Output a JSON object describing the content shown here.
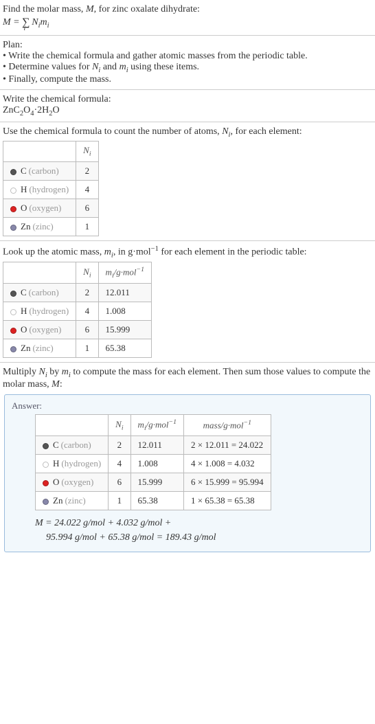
{
  "sec1": {
    "text": "Find the molar mass, M, for zinc oxalate dihydrate:",
    "formula_lhs": "M = ",
    "formula_sigma": "∑",
    "formula_sigma_sub": "i",
    "formula_rhs1": " N",
    "formula_rhs2": "m",
    "formula_sub": "i"
  },
  "plan": {
    "title": "Plan:",
    "items": [
      "• Write the chemical formula and gather atomic masses from the periodic table.",
      "• Determine values for Nᵢ and mᵢ using these items.",
      "• Finally, compute the mass."
    ]
  },
  "chem": {
    "title": "Write the chemical formula:",
    "formula_parts": [
      "ZnC",
      "2",
      "O",
      "4",
      "·2H",
      "2",
      "O"
    ]
  },
  "count": {
    "title_pre": "Use the chemical formula to count the number of atoms, ",
    "title_var": "N",
    "title_sub": "i",
    "title_post": ", for each element:",
    "header_ni": "Nᵢ",
    "rows": [
      {
        "sym": "C",
        "name": "(carbon)",
        "n": "2",
        "dot": "dot-c"
      },
      {
        "sym": "H",
        "name": "(hydrogen)",
        "n": "4",
        "dot": "dot-h"
      },
      {
        "sym": "O",
        "name": "(oxygen)",
        "n": "6",
        "dot": "dot-o"
      },
      {
        "sym": "Zn",
        "name": "(zinc)",
        "n": "1",
        "dot": "dot-zn"
      }
    ]
  },
  "mass": {
    "title_pre": "Look up the atomic mass, ",
    "title_var": "m",
    "title_sub": "i",
    "title_mid": ", in g·mol",
    "title_sup": "−1",
    "title_post": " for each element in the periodic table:",
    "header_ni": "Nᵢ",
    "header_mi": "mᵢ/g·mol⁻¹",
    "rows": [
      {
        "sym": "C",
        "name": "(carbon)",
        "n": "2",
        "m": "12.011",
        "dot": "dot-c"
      },
      {
        "sym": "H",
        "name": "(hydrogen)",
        "n": "4",
        "m": "1.008",
        "dot": "dot-h"
      },
      {
        "sym": "O",
        "name": "(oxygen)",
        "n": "6",
        "m": "15.999",
        "dot": "dot-o"
      },
      {
        "sym": "Zn",
        "name": "(zinc)",
        "n": "1",
        "m": "65.38",
        "dot": "dot-zn"
      }
    ]
  },
  "mult": {
    "text_pre": "Multiply ",
    "n": "N",
    "ni": "i",
    "text_mid": " by ",
    "m": "m",
    "mi": "i",
    "text_post": " to compute the mass for each element. Then sum those values to compute the molar mass, ",
    "mvar": "M",
    "text_end": ":"
  },
  "answer": {
    "title": "Answer:",
    "header_ni": "Nᵢ",
    "header_mi": "mᵢ/g·mol⁻¹",
    "header_mass": "mass/g·mol⁻¹",
    "rows": [
      {
        "sym": "C",
        "name": "(carbon)",
        "n": "2",
        "m": "12.011",
        "calc": "2 × 12.011 = 24.022",
        "dot": "dot-c"
      },
      {
        "sym": "H",
        "name": "(hydrogen)",
        "n": "4",
        "m": "1.008",
        "calc": "4 × 1.008 = 4.032",
        "dot": "dot-h"
      },
      {
        "sym": "O",
        "name": "(oxygen)",
        "n": "6",
        "m": "15.999",
        "calc": "6 × 15.999 = 95.994",
        "dot": "dot-o"
      },
      {
        "sym": "Zn",
        "name": "(zinc)",
        "n": "1",
        "m": "65.38",
        "calc": "1 × 65.38 = 65.38",
        "dot": "dot-zn"
      }
    ],
    "final1": "M = 24.022 g/mol + 4.032 g/mol +",
    "final2": "95.994 g/mol + 65.38 g/mol = 189.43 g/mol"
  }
}
